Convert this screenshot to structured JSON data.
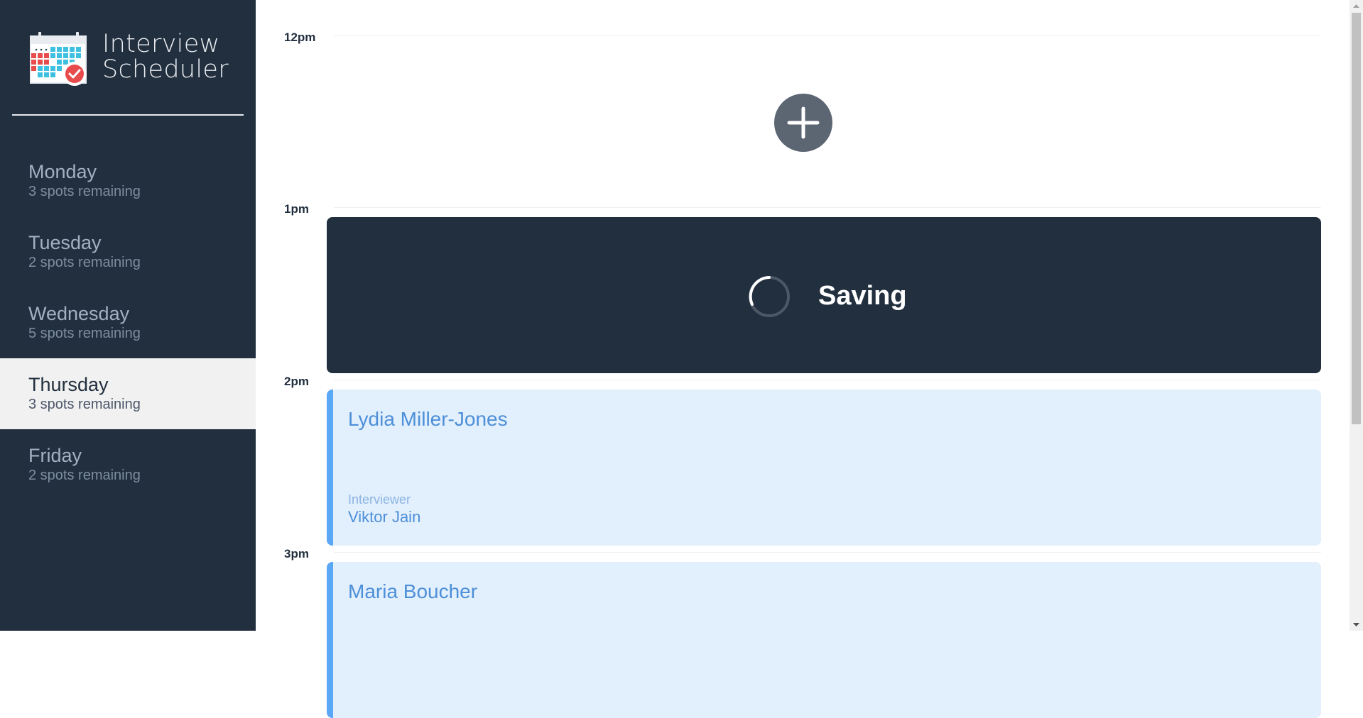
{
  "app": {
    "title_line1": "Interview",
    "title_line2": "Scheduler",
    "logo_icon": "calendar-check-icon"
  },
  "days": [
    {
      "name": "Monday",
      "spots": "3 spots remaining",
      "selected": false
    },
    {
      "name": "Tuesday",
      "spots": "2 spots remaining",
      "selected": false
    },
    {
      "name": "Wednesday",
      "spots": "5 spots remaining",
      "selected": false
    },
    {
      "name": "Thursday",
      "spots": "3 spots remaining",
      "selected": true
    },
    {
      "name": "Friday",
      "spots": "2 spots remaining",
      "selected": false
    }
  ],
  "schedule": {
    "slots": [
      {
        "time": "12pm",
        "state": "empty",
        "add_icon": "plus-icon"
      },
      {
        "time": "1pm",
        "state": "saving",
        "status": "Saving",
        "status_icon": "spinner-icon"
      },
      {
        "time": "2pm",
        "state": "booked",
        "student": "Lydia Miller-Jones",
        "interviewer_label": "Interviewer",
        "interviewer": "Viktor Jain"
      },
      {
        "time": "3pm",
        "state": "booked",
        "student": "Maria Boucher"
      }
    ]
  },
  "colors": {
    "sidebar_bg": "#222f3e",
    "selected_day_bg": "#f1f1f1",
    "status_bg": "#222f3e",
    "appointment_bg": "#e2effc",
    "appointment_accent": "#5aa7f5",
    "add_button_bg": "#5c6572"
  }
}
